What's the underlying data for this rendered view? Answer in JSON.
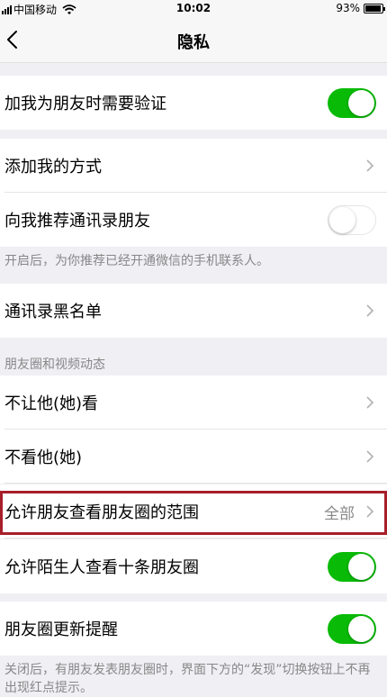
{
  "status_bar": {
    "carrier": "中国移动",
    "time": "10:02",
    "battery": "93%",
    "battery_level": 0.93
  },
  "nav": {
    "title": "隐私"
  },
  "settings": {
    "verify_friend": {
      "label": "加我为朋友时需要验证",
      "enabled": true
    },
    "add_methods": {
      "label": "添加我的方式"
    },
    "recommend_contacts": {
      "label": "向我推荐通讯录朋友",
      "enabled": false,
      "note": "开启后，为你推荐已经开通微信的手机联系人。"
    },
    "blacklist": {
      "label": "通讯录黑名单"
    }
  },
  "moments_section": {
    "header": "朋友圈和视频动态",
    "hide_my_posts": {
      "label": "不让他(她)看"
    },
    "hide_their_posts": {
      "label": "不看他(她)"
    },
    "visible_range": {
      "label": "允许朋友查看朋友圈的范围",
      "value": "全部"
    },
    "stranger_view": {
      "label": "允许陌生人查看十条朋友圈",
      "enabled": true
    },
    "update_reminder": {
      "label": "朋友圈更新提醒",
      "enabled": true,
      "note": "关闭后，有朋友发表朋友圈时，界面下方的“发现”切换按钮上不再出现红点提示。"
    }
  }
}
